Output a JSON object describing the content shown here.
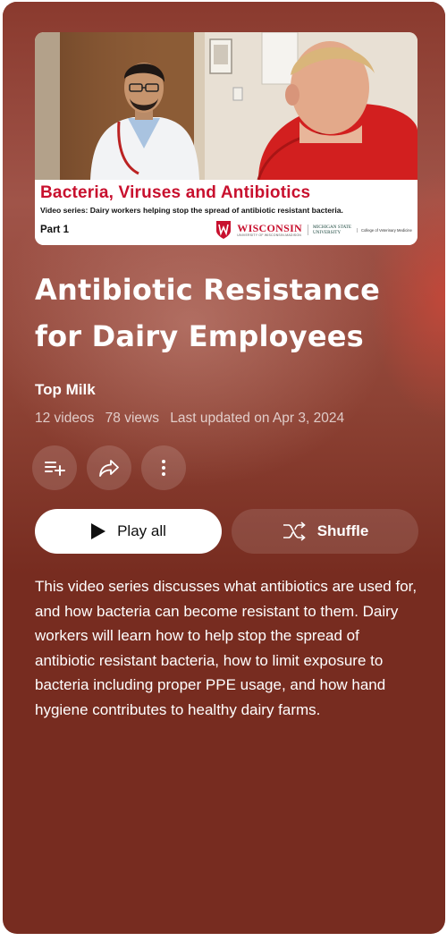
{
  "thumbnail": {
    "title": "Bacteria, Viruses and Antibiotics",
    "subtitle": "Video series: Dairy workers helping stop the spread of antibiotic resistant bacteria.",
    "part": "Part 1",
    "logo_uw": "WISCONSIN",
    "logo_uw_sub": "UNIVERSITY OF WISCONSIN-MADISON",
    "logo_msu": "MICHIGAN STATE\nUNIVERSITY",
    "logo_cvm": "College of Veterinary Medicine"
  },
  "playlist": {
    "title": "Antibiotic Resistance for Dairy Employees",
    "channel": "Top Milk",
    "video_count": "12 videos",
    "views": "78 views",
    "updated": "Last updated on Apr 3, 2024",
    "description": "This video series discusses what antibiotics are used for, and how bacteria can become resistant to them. Dairy workers will learn how to help stop the spread of antibiotic resistant bacteria, how to limit exposure to bacteria including proper PPE usage, and how hand hygiene contributes to healthy dairy farms."
  },
  "actions": {
    "play_all": "Play all",
    "shuffle": "Shuffle"
  },
  "icons": {
    "save": "playlist-add-icon",
    "share": "share-icon",
    "more": "more-vert-icon",
    "play": "play-icon",
    "shuffle": "shuffle-icon"
  },
  "colors": {
    "panel_bg": "#772c20",
    "banner_red": "#c8102e",
    "play_button_bg": "#ffffff"
  }
}
